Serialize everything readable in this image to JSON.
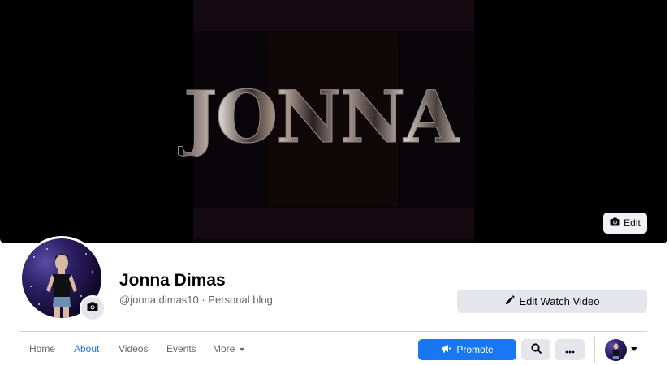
{
  "cover": {
    "title": "JONNA",
    "edit_label": "Edit"
  },
  "profile": {
    "name": "Jonna Dimas",
    "handle": "@jonna.dimas10",
    "separator": " · ",
    "category": "Personal blog"
  },
  "actions": {
    "edit_watch_video_label": "Edit Watch Video",
    "promote_label": "Promote"
  },
  "nav": {
    "items": [
      {
        "label": "Home",
        "active": false
      },
      {
        "label": "About",
        "active": true
      },
      {
        "label": "Videos",
        "active": false
      },
      {
        "label": "Events",
        "active": false
      },
      {
        "label": "More",
        "active": false
      }
    ]
  },
  "icons": {
    "camera": "camera-icon",
    "pencil": "pencil-icon",
    "megaphone": "megaphone-icon",
    "search": "search-icon",
    "more": "ellipsis-icon",
    "dropdown": "caret-down-icon"
  },
  "colors": {
    "accent": "#1877f2",
    "active_tab": "#1b74e4",
    "button_gray": "#e4e6eb",
    "muted_text": "#65676b"
  }
}
